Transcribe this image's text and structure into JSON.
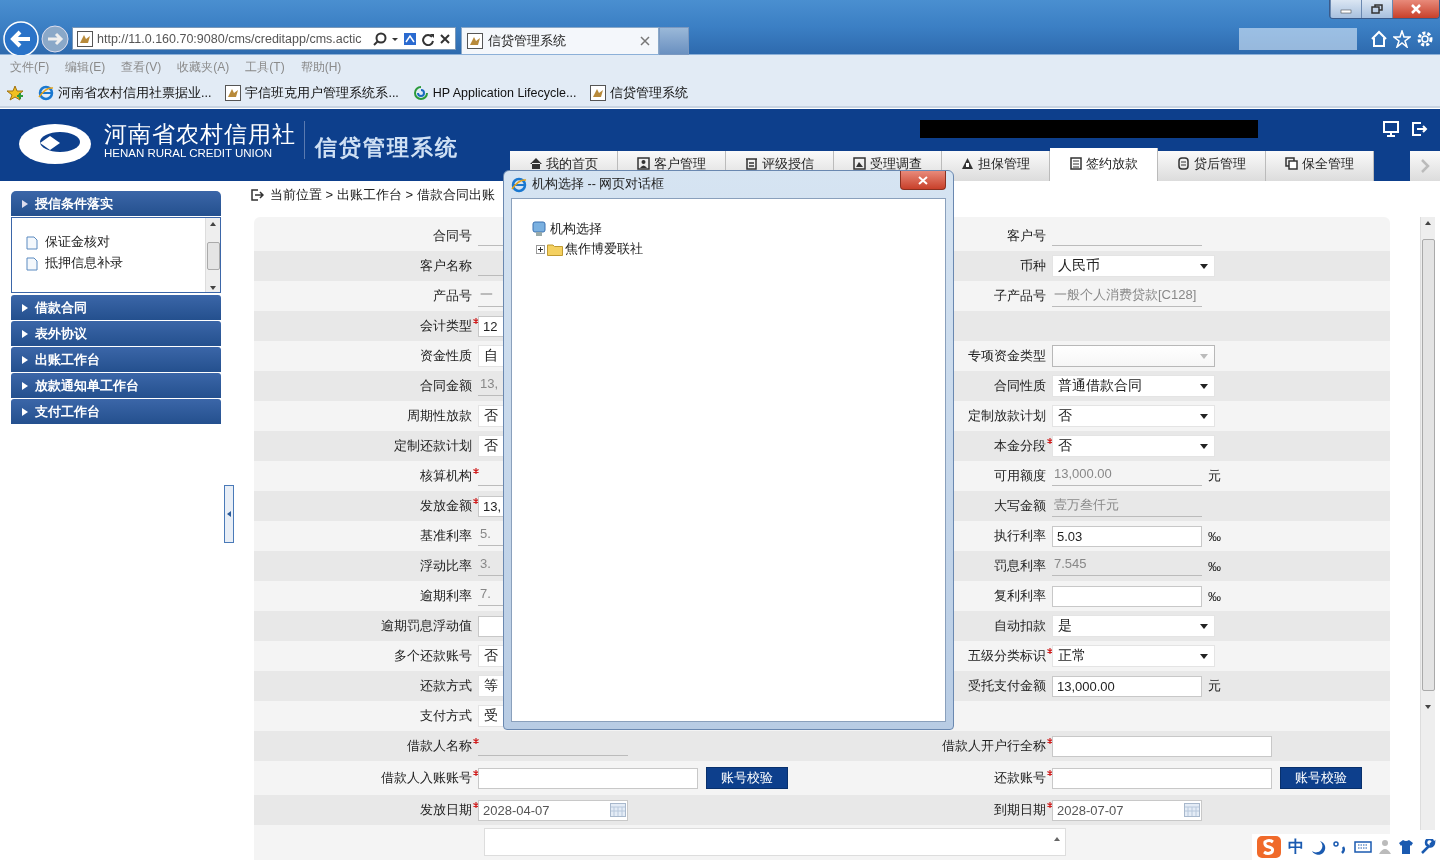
{
  "browser": {
    "address": "http://11.0.160.70:9080/cms/creditapp/cms.actic",
    "tabs": [
      {
        "label": "信贷管理系统",
        "selected": true
      }
    ],
    "menu": [
      "文件(F)",
      "编辑(E)",
      "查看(V)",
      "收藏夹(A)",
      "工具(T)",
      "帮助(H)"
    ],
    "favorites": [
      {
        "label": "河南省农村信用社票据业...",
        "kind": "ie"
      },
      {
        "label": "宇信班克用户管理系统系...",
        "kind": "app"
      },
      {
        "label": "HP Application Lifecycle...",
        "kind": "hp"
      },
      {
        "label": "信贷管理系统",
        "kind": "app"
      }
    ]
  },
  "header": {
    "org_name": "河南省农村信用社",
    "org_name_en": "HENAN RURAL CREDIT UNION",
    "system_name": "信贷管理系统",
    "nav": [
      {
        "label": "我的首页",
        "selected": false
      },
      {
        "label": "客户管理",
        "selected": false
      },
      {
        "label": "评级授信",
        "selected": false
      },
      {
        "label": "受理调查",
        "selected": false
      },
      {
        "label": "担保管理",
        "selected": false
      },
      {
        "label": "签约放款",
        "selected": true
      },
      {
        "label": "贷后管理",
        "selected": false
      },
      {
        "label": "保全管理",
        "selected": false
      }
    ]
  },
  "sidebar": {
    "sections": [
      {
        "label": "授信条件落实",
        "expanded": true,
        "items": [
          "保证金核对",
          "抵押信息补录"
        ]
      },
      {
        "label": "借款合同",
        "expanded": false
      },
      {
        "label": "表外协议",
        "expanded": false
      },
      {
        "label": "出账工作台",
        "expanded": false
      },
      {
        "label": "放款通知单工作台",
        "expanded": false
      },
      {
        "label": "支付工作台",
        "expanded": false
      }
    ]
  },
  "breadcrumb": "当前位置 > 出账工作台 > 借款合同出账",
  "form": {
    "rows": [
      {
        "left": {
          "label": "合同号",
          "required": false,
          "kind": "readonly"
        },
        "right": {
          "label": "客户号",
          "required": false,
          "kind": "readonly"
        }
      },
      {
        "left": {
          "label": "客户名称",
          "required": false,
          "kind": "readonly"
        },
        "right": {
          "label": "币种",
          "required": false,
          "kind": "select",
          "value": "人民币",
          "disabled": false
        }
      },
      {
        "left": {
          "label": "产品号",
          "required": false,
          "kind": "readonly",
          "value": "一"
        },
        "right": {
          "label": "子产品号",
          "required": false,
          "kind": "readonly",
          "value": "一般个人消费贷款[C128]"
        }
      },
      {
        "left": {
          "label": "会计类型",
          "required": true,
          "kind": "text",
          "value": "12"
        }
      },
      {
        "left": {
          "label": "资金性质",
          "required": false,
          "kind": "select",
          "value": "自",
          "disabled": false
        },
        "right": {
          "label": "专项资金类型",
          "required": false,
          "kind": "select",
          "disabled": true
        }
      },
      {
        "left": {
          "label": "合同金额",
          "required": false,
          "kind": "readonly",
          "value": "13,"
        },
        "right": {
          "label": "合同性质",
          "required": false,
          "kind": "select",
          "value": "普通借款合同",
          "disabled": false
        }
      },
      {
        "left": {
          "label": "周期性放款",
          "required": false,
          "kind": "select",
          "value": "否",
          "disabled": false
        },
        "right": {
          "label": "定制放款计划",
          "required": false,
          "kind": "select",
          "value": "否",
          "disabled": false
        }
      },
      {
        "left": {
          "label": "定制还款计划",
          "required": false,
          "kind": "select",
          "value": "否",
          "disabled": false
        },
        "right": {
          "label": "本金分段",
          "required": true,
          "kind": "select",
          "value": "否",
          "disabled": false
        }
      },
      {
        "left": {
          "label": "核算机构",
          "required": true,
          "kind": "readonly"
        },
        "right": {
          "label": "可用额度",
          "required": false,
          "kind": "readonly",
          "value": "13,000.00",
          "unit": "元"
        }
      },
      {
        "left": {
          "label": "发放金额",
          "required": true,
          "kind": "text",
          "value": "13,"
        },
        "right": {
          "label": "大写金额",
          "required": false,
          "kind": "readonly",
          "value": "壹万叁仟元"
        }
      },
      {
        "left": {
          "label": "基准利率",
          "required": false,
          "kind": "readonly",
          "value": "5."
        },
        "right": {
          "label": "执行利率",
          "required": false,
          "kind": "text",
          "value": "5.03",
          "unit": "‰"
        }
      },
      {
        "left": {
          "label": "浮动比率",
          "required": false,
          "kind": "readonly",
          "value": "3."
        },
        "right": {
          "label": "罚息利率",
          "required": false,
          "kind": "readonly",
          "value": "7.545",
          "unit": "‰"
        }
      },
      {
        "left": {
          "label": "逾期利率",
          "required": false,
          "kind": "readonly",
          "value": "7."
        },
        "right": {
          "label": "复利利率",
          "required": false,
          "kind": "text",
          "unit": "‰"
        }
      },
      {
        "left": {
          "label": "逾期罚息浮动值",
          "required": false,
          "kind": "text"
        },
        "right": {
          "label": "自动扣款",
          "required": false,
          "kind": "select",
          "value": "是",
          "disabled": false
        }
      },
      {
        "left": {
          "label": "多个还款账号",
          "required": false,
          "kind": "select",
          "value": "否",
          "disabled": false
        },
        "right": {
          "label": "五级分类标识",
          "required": true,
          "kind": "select",
          "value": "正常",
          "disabled": false
        }
      },
      {
        "left": {
          "label": "还款方式",
          "required": false,
          "kind": "select",
          "value": "等",
          "disabled": false
        },
        "right": {
          "label": "受托支付金额",
          "required": false,
          "kind": "text",
          "value": "13,000.00",
          "unit": "元"
        }
      },
      {
        "left": {
          "label": "支付方式",
          "required": false,
          "kind": "select",
          "value": "受",
          "disabled": false
        }
      },
      {
        "left": {
          "label": "借款人名称",
          "required": true,
          "kind": "readonly"
        },
        "right": {
          "label": "借款人开户行全称",
          "required": true,
          "kind": "wide"
        }
      },
      {
        "left": {
          "label": "借款人入账账号",
          "required": true,
          "kind": "account",
          "button": "账号校验"
        },
        "right": {
          "label": "还款账号",
          "required": true,
          "kind": "account",
          "button": "账号校验"
        }
      },
      {
        "left": {
          "label": "发放日期",
          "required": true,
          "kind": "date",
          "value": "2028-04-07"
        },
        "right": {
          "label": "到期日期",
          "required": true,
          "kind": "date",
          "value": "2028-07-07"
        }
      },
      {
        "left": {
          "kind": "textarea"
        }
      }
    ]
  },
  "dialog": {
    "title": "机构选择 -- 网页对话框",
    "tree": {
      "label": "机构选择",
      "children": [
        {
          "label": "焦作博爱联社",
          "expanded": false
        }
      ]
    }
  },
  "ime": {
    "label": "中"
  }
}
